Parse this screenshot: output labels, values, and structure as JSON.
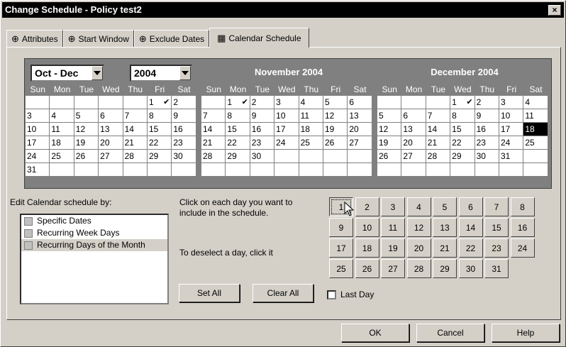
{
  "window": {
    "title": "Change Schedule - Policy test2",
    "close_label": "×"
  },
  "tabs": [
    {
      "label": "Attributes",
      "icon": "attributes-icon"
    },
    {
      "label": "Start Window",
      "icon": "start-window-icon"
    },
    {
      "label": "Exclude Dates",
      "icon": "exclude-dates-icon"
    },
    {
      "label": "Calendar Schedule",
      "icon": "calendar-icon",
      "active": true
    }
  ],
  "calendar": {
    "range_select": "Oct - Dec",
    "year_select": "2004",
    "weekdays": [
      "Sun",
      "Mon",
      "Tue",
      "Wed",
      "Thu",
      "Fri",
      "Sat"
    ],
    "months": [
      {
        "title": "",
        "cells": [
          "",
          "",
          "",
          "",
          "",
          "1",
          "2",
          "3",
          "4",
          "5",
          "6",
          "7",
          "8",
          "9",
          "10",
          "11",
          "12",
          "13",
          "14",
          "15",
          "16",
          "17",
          "18",
          "19",
          "20",
          "21",
          "22",
          "23",
          "24",
          "25",
          "26",
          "27",
          "28",
          "29",
          "30",
          "31",
          "",
          "",
          "",
          "",
          "",
          ""
        ],
        "checked": [
          "1"
        ],
        "selected": []
      },
      {
        "title": "November 2004",
        "cells": [
          "",
          "1",
          "2",
          "3",
          "4",
          "5",
          "6",
          "7",
          "8",
          "9",
          "10",
          "11",
          "12",
          "13",
          "14",
          "15",
          "16",
          "17",
          "18",
          "19",
          "20",
          "21",
          "22",
          "23",
          "24",
          "25",
          "26",
          "27",
          "28",
          "29",
          "30",
          "",
          "",
          "",
          "",
          "",
          "",
          "",
          "",
          "",
          "",
          ""
        ],
        "checked": [
          "1"
        ],
        "selected": []
      },
      {
        "title": "December 2004",
        "cells": [
          "",
          "",
          "",
          "1",
          "2",
          "3",
          "4",
          "5",
          "6",
          "7",
          "8",
          "9",
          "10",
          "11",
          "12",
          "13",
          "14",
          "15",
          "16",
          "17",
          "18",
          "19",
          "20",
          "21",
          "22",
          "23",
          "24",
          "25",
          "26",
          "27",
          "28",
          "29",
          "30",
          "31",
          "",
          "",
          "",
          "",
          "",
          "",
          "",
          ""
        ],
        "checked": [
          "1"
        ],
        "selected": [
          "18"
        ]
      }
    ]
  },
  "edit_by": {
    "label": "Edit Calendar schedule by:",
    "options": [
      {
        "label": "Specific Dates",
        "icon": "specific-dates-icon"
      },
      {
        "label": "Recurring Week Days",
        "icon": "recurring-week-days-icon"
      },
      {
        "label": "Recurring Days of the Month",
        "icon": "recurring-days-month-icon",
        "active": true
      }
    ]
  },
  "instructions": {
    "line1": "Click on each day you want to",
    "line2": "include in the schedule.",
    "line3": "To deselect a day, click it"
  },
  "days_of_month": [
    "1",
    "2",
    "3",
    "4",
    "5",
    "6",
    "7",
    "8",
    "9",
    "10",
    "11",
    "12",
    "13",
    "14",
    "15",
    "16",
    "17",
    "18",
    "19",
    "20",
    "21",
    "22",
    "23",
    "24",
    "25",
    "26",
    "27",
    "28",
    "29",
    "30",
    "31"
  ],
  "pressed_day": "1",
  "buttons": {
    "set_all": "Set All",
    "clear_all": "Clear All",
    "ok": "OK",
    "cancel": "Cancel",
    "help": "Help"
  },
  "last_day": {
    "label": "Last Day",
    "checked": false
  }
}
